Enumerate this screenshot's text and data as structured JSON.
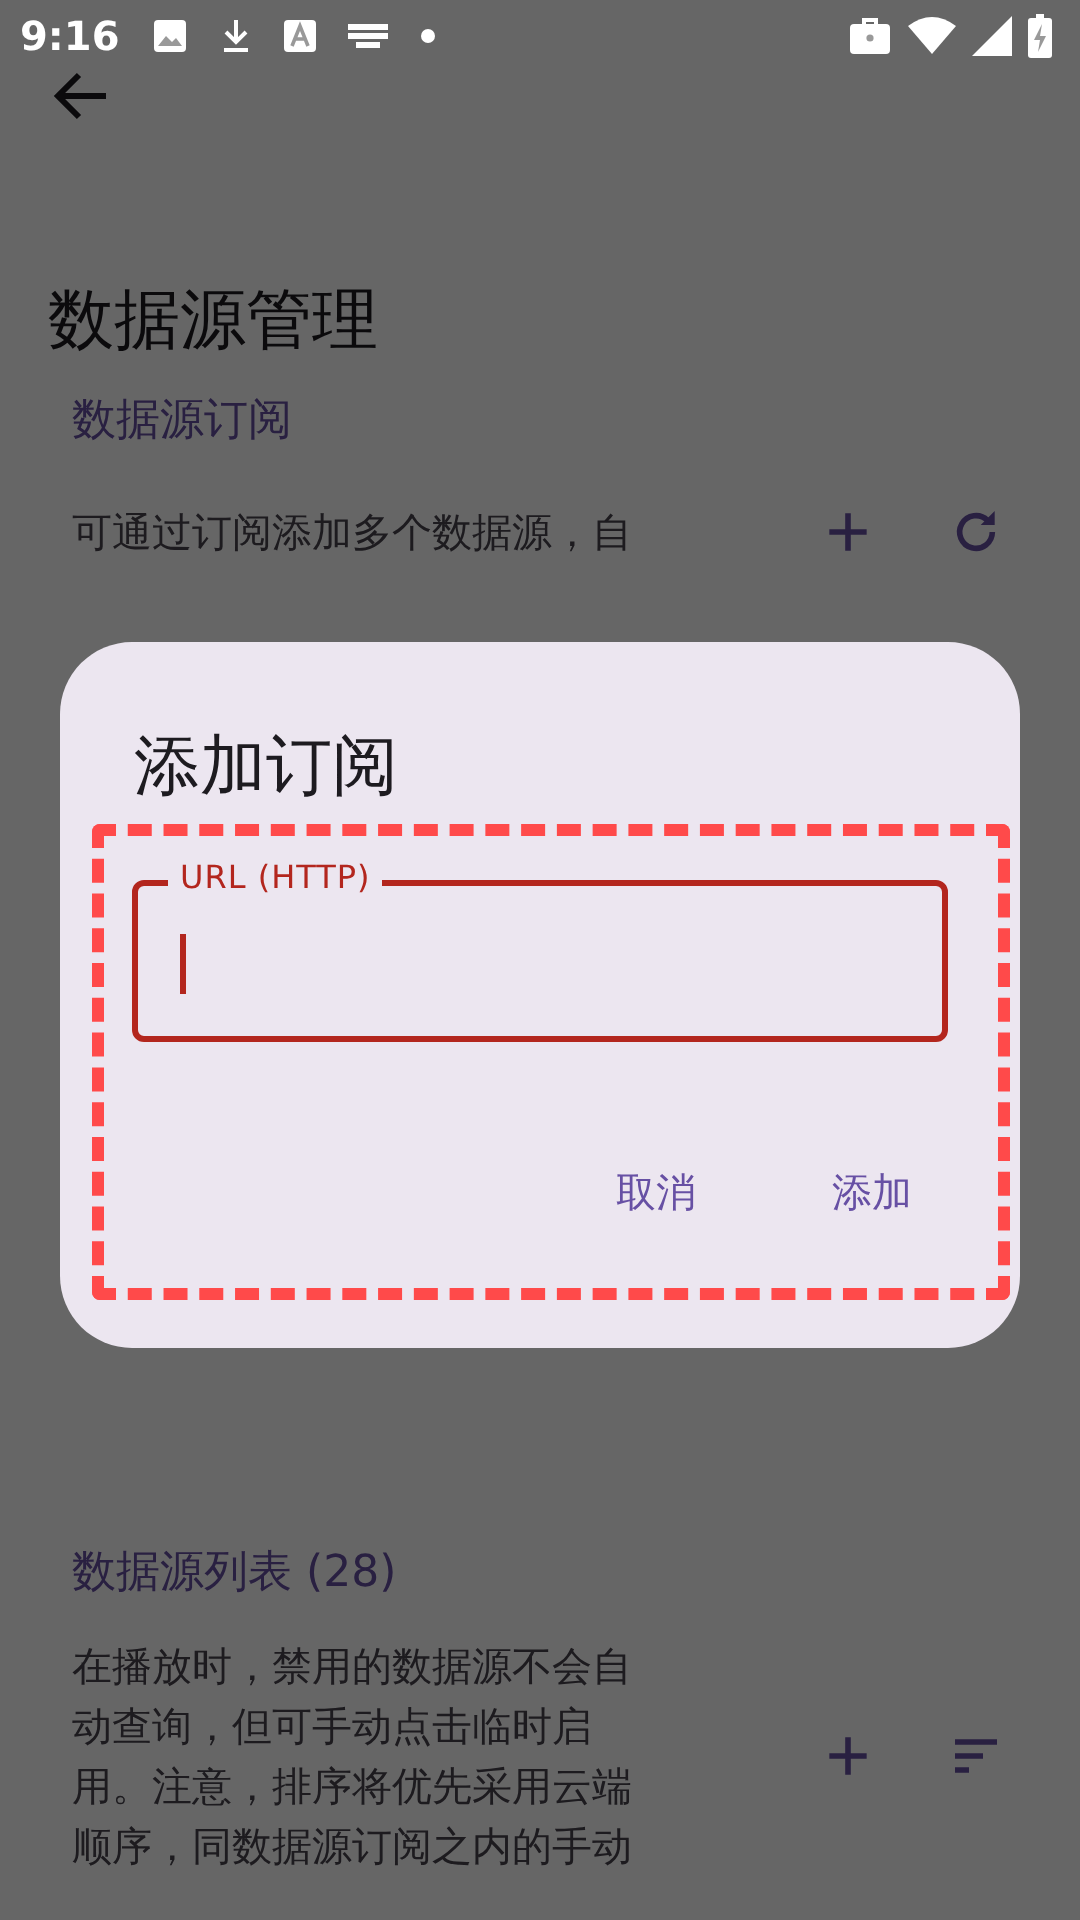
{
  "status_bar": {
    "time": "9:16"
  },
  "page": {
    "title": "数据源管理"
  },
  "sections": [
    {
      "title": "数据源订阅",
      "description_lines": [
        "可通过订阅添加多个数据源，自"
      ],
      "actions": [
        {
          "kind": "add"
        },
        {
          "kind": "refresh"
        }
      ]
    },
    {
      "title": "数据源列表 (28)",
      "description_lines": [
        "在播放时，禁用的数据源不会自",
        "动查询，但可手动点击临时启",
        "用。注意，排序将优先采用云端",
        "顺序，同数据源订阅之内的手动"
      ],
      "actions": [
        {
          "kind": "add"
        },
        {
          "kind": "sort"
        }
      ]
    }
  ],
  "dialog": {
    "title": "添加订阅",
    "field": {
      "label": "URL (HTTP)",
      "focused": true
    },
    "buttons": [
      "取消",
      "添加"
    ]
  },
  "annotation": {
    "kind": "dashed-frame",
    "color": "#ff4a4a"
  }
}
